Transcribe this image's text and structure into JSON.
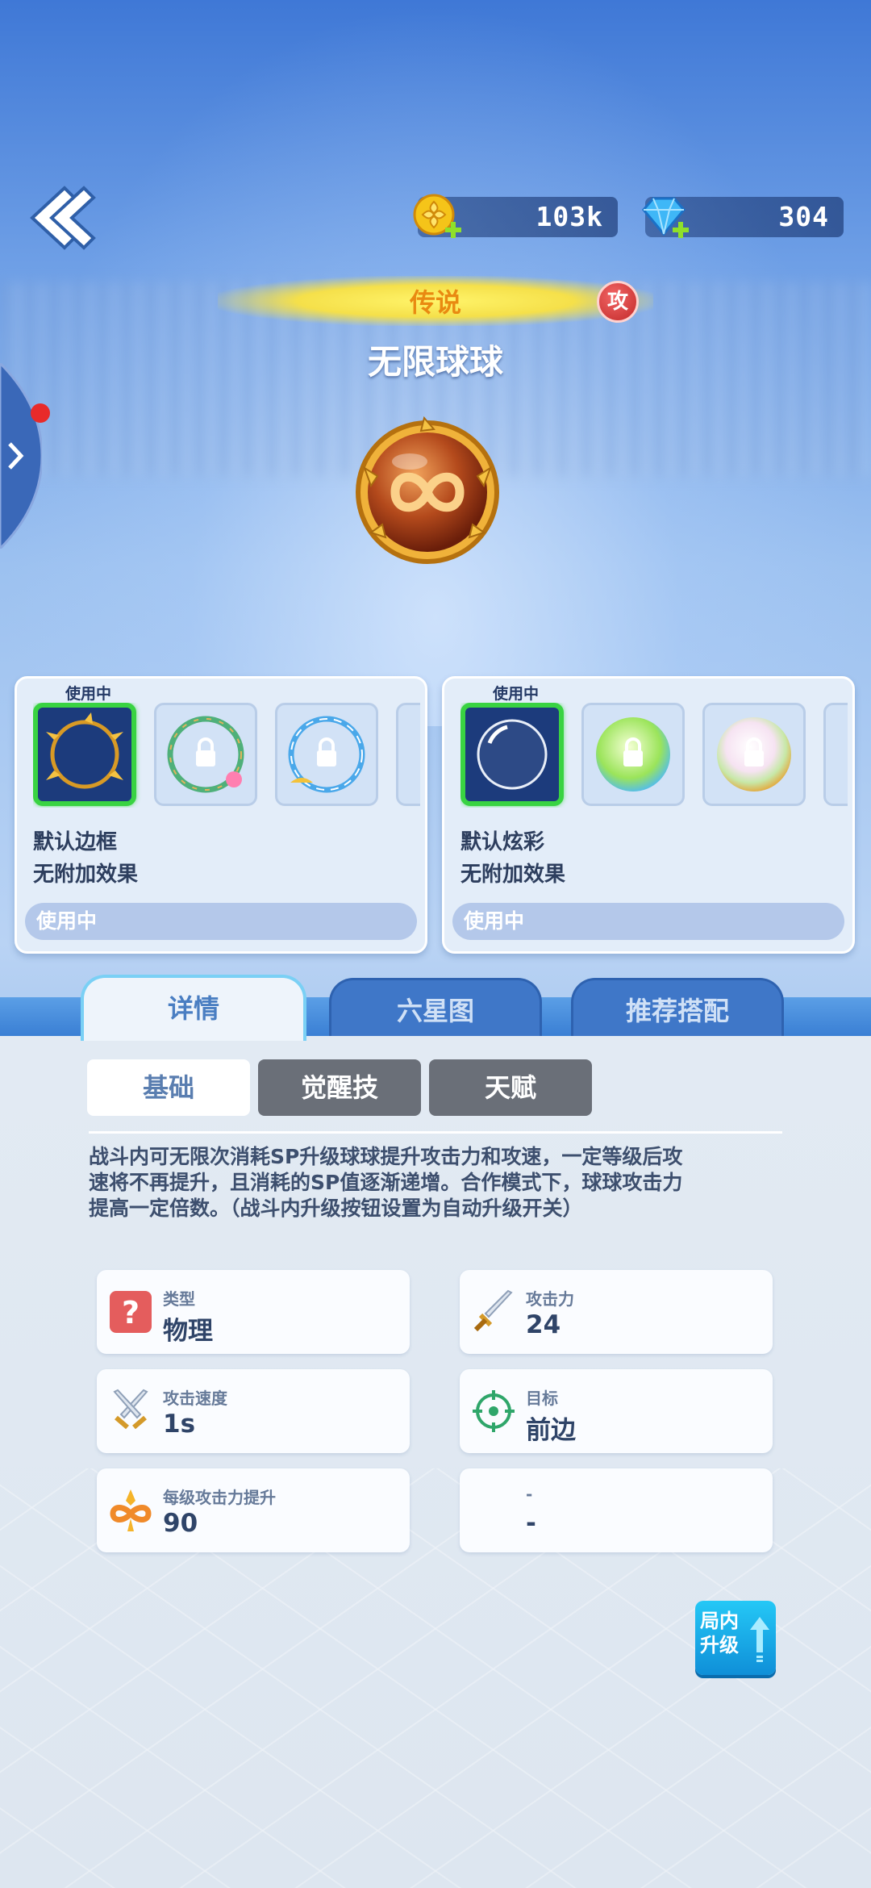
{
  "header": {
    "gold_amount": "103k",
    "gem_amount": "304"
  },
  "item": {
    "rarity": "传说",
    "attack_badge": "攻",
    "name": "无限球球"
  },
  "frame_panel": {
    "in_use_tag": "使用中",
    "skin_name": "默认边框",
    "skin_effect": "无附加效果",
    "status_button": "使用中"
  },
  "color_panel": {
    "in_use_tag": "使用中",
    "skin_name": "默认炫彩",
    "skin_effect": "无附加效果",
    "status_button": "使用中"
  },
  "tabs": {
    "details": "详情",
    "hexagram": "六星图",
    "recommended": "推荐搭配"
  },
  "subtabs": {
    "basic": "基础",
    "awaken_skill": "觉醒技",
    "talent": "天赋"
  },
  "description": "战斗内可无限次消耗SP升级球球提升攻击力和攻速，一定等级后攻速将不再提升，且消耗的SP值逐渐递增。合作模式下，球球攻击力提高一定倍数。（战斗内升级按钮设置为自动升级开关）",
  "stats": {
    "type_label": "类型",
    "type_value": "物理",
    "attack_label": "攻击力",
    "attack_value": "24",
    "speed_label": "攻击速度",
    "speed_value": "1s",
    "target_label": "目标",
    "target_value": "前边",
    "per_level_label": "每级攻击力提升",
    "per_level_value": "90",
    "empty_label": "-",
    "empty_value": "-"
  },
  "upgrade_button": {
    "line1": "局内",
    "line2": "升级"
  },
  "colors": {
    "rarity_text": "#e98a11",
    "active_border": "#39d342",
    "tab_active_border": "#7ad0f5",
    "upgrade_button": "#19aeea"
  }
}
